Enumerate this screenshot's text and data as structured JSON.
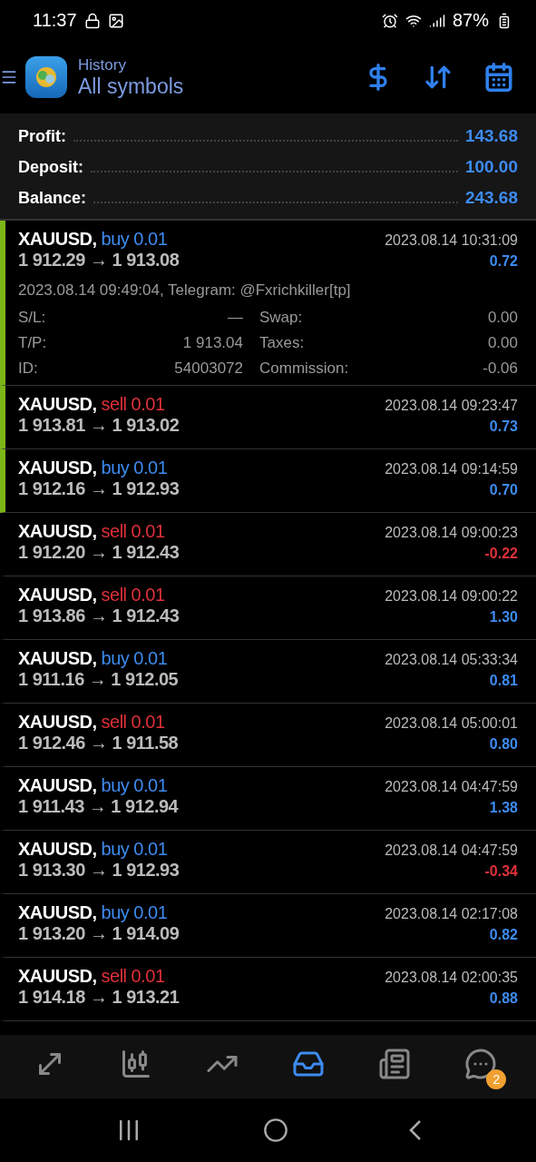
{
  "status_bar": {
    "time": "11:37",
    "battery": "87%"
  },
  "header": {
    "subtitle": "History",
    "title": "All symbols"
  },
  "summary": [
    {
      "label": "Profit:",
      "value": "143.68"
    },
    {
      "label": "Deposit:",
      "value": "100.00"
    },
    {
      "label": "Balance:",
      "value": "243.68"
    }
  ],
  "deals": [
    {
      "symbol": "XAUUSD,",
      "side": "buy",
      "volume": "0.01",
      "prices": "1 912.29 → 1 913.08",
      "time": "2023.08.14 10:31:09",
      "profit": "0.72",
      "loss": false,
      "marked": true,
      "expanded": true,
      "comment": "2023.08.14 09:49:04, Telegram: @Fxrichkiller[tp]",
      "details": [
        {
          "label": "S/L:",
          "value": "—",
          "label_2": "Swap:",
          "value_2": "0.00"
        },
        {
          "label": "T/P:",
          "value": "1 913.04",
          "label_2": "Taxes:",
          "value_2": "0.00"
        },
        {
          "label": "ID:",
          "value": "54003072",
          "label_2": "Commission:",
          "value_2": "-0.06"
        }
      ]
    },
    {
      "symbol": "XAUUSD,",
      "side": "sell",
      "volume": "0.01",
      "prices": "1 913.81 → 1 913.02",
      "time": "2023.08.14 09:23:47",
      "profit": "0.73",
      "loss": false,
      "marked": true,
      "expanded": false
    },
    {
      "symbol": "XAUUSD,",
      "side": "buy",
      "volume": "0.01",
      "prices": "1 912.16 → 1 912.93",
      "time": "2023.08.14 09:14:59",
      "profit": "0.70",
      "loss": false,
      "marked": true,
      "expanded": false
    },
    {
      "symbol": "XAUUSD,",
      "side": "sell",
      "volume": "0.01",
      "prices": "1 912.20 → 1 912.43",
      "time": "2023.08.14 09:00:23",
      "profit": "-0.22",
      "loss": true,
      "marked": false,
      "expanded": false
    },
    {
      "symbol": "XAUUSD,",
      "side": "sell",
      "volume": "0.01",
      "prices": "1 913.86 → 1 912.43",
      "time": "2023.08.14 09:00:22",
      "profit": "1.30",
      "loss": false,
      "marked": false,
      "expanded": false
    },
    {
      "symbol": "XAUUSD,",
      "side": "buy",
      "volume": "0.01",
      "prices": "1 911.16 → 1 912.05",
      "time": "2023.08.14 05:33:34",
      "profit": "0.81",
      "loss": false,
      "marked": false,
      "expanded": false
    },
    {
      "symbol": "XAUUSD,",
      "side": "sell",
      "volume": "0.01",
      "prices": "1 912.46 → 1 911.58",
      "time": "2023.08.14 05:00:01",
      "profit": "0.80",
      "loss": false,
      "marked": false,
      "expanded": false
    },
    {
      "symbol": "XAUUSD,",
      "side": "buy",
      "volume": "0.01",
      "prices": "1 911.43 → 1 912.94",
      "time": "2023.08.14 04:47:59",
      "profit": "1.38",
      "loss": false,
      "marked": false,
      "expanded": false
    },
    {
      "symbol": "XAUUSD,",
      "side": "buy",
      "volume": "0.01",
      "prices": "1 913.30 → 1 912.93",
      "time": "2023.08.14 04:47:59",
      "profit": "-0.34",
      "loss": true,
      "marked": false,
      "expanded": false
    },
    {
      "symbol": "XAUUSD,",
      "side": "buy",
      "volume": "0.01",
      "prices": "1 913.20 → 1 914.09",
      "time": "2023.08.14 02:17:08",
      "profit": "0.82",
      "loss": false,
      "marked": false,
      "expanded": false
    },
    {
      "symbol": "XAUUSD,",
      "side": "sell",
      "volume": "0.01",
      "prices": "1 914.18 → 1 913.21",
      "time": "2023.08.14 02:00:35",
      "profit": "0.88",
      "loss": false,
      "marked": false,
      "expanded": false
    }
  ],
  "bottom_nav": [
    {
      "kind": "trade",
      "selected": false
    },
    {
      "kind": "quotes",
      "selected": false
    },
    {
      "kind": "chart",
      "selected": false
    },
    {
      "kind": "history",
      "selected": true
    },
    {
      "kind": "news",
      "selected": false
    },
    {
      "kind": "chat",
      "selected": false,
      "badge": "2"
    }
  ]
}
